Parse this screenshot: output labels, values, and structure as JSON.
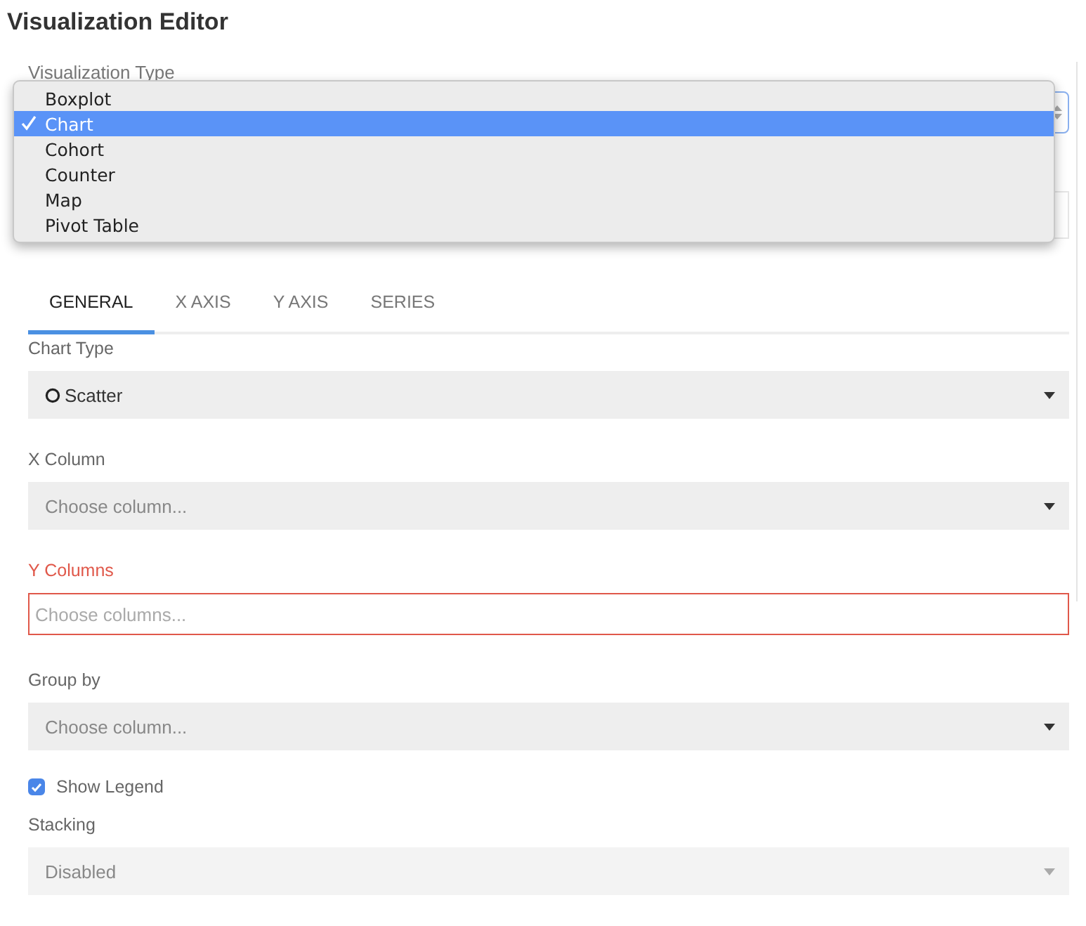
{
  "title": "Visualization Editor",
  "visualization_type": {
    "label": "Visualization Type",
    "options": [
      {
        "label": "Boxplot",
        "selected": false
      },
      {
        "label": "Chart",
        "selected": true
      },
      {
        "label": "Cohort",
        "selected": false
      },
      {
        "label": "Counter",
        "selected": false
      },
      {
        "label": "Map",
        "selected": false
      },
      {
        "label": "Pivot Table",
        "selected": false
      }
    ]
  },
  "tabs": [
    {
      "label": "GENERAL",
      "selected": true
    },
    {
      "label": "X AXIS",
      "selected": false
    },
    {
      "label": "Y AXIS",
      "selected": false
    },
    {
      "label": "SERIES",
      "selected": false
    }
  ],
  "fields": [
    {
      "kind": "select",
      "label": "Chart Type",
      "value": "Scatter",
      "error": false
    },
    {
      "kind": "select",
      "label": "X Column",
      "placeholder": "Choose column...",
      "error": false
    },
    {
      "kind": "input",
      "label": "Y Columns",
      "placeholder": "Choose columns...",
      "error": true
    },
    {
      "kind": "select",
      "label": "Group by",
      "placeholder": "Choose column...",
      "error": false
    },
    {
      "kind": "checkbox",
      "label": "Show Legend",
      "checked": true
    },
    {
      "kind": "select",
      "label": "Stacking",
      "value": "Disabled",
      "error": false,
      "disabled": true
    }
  ]
}
